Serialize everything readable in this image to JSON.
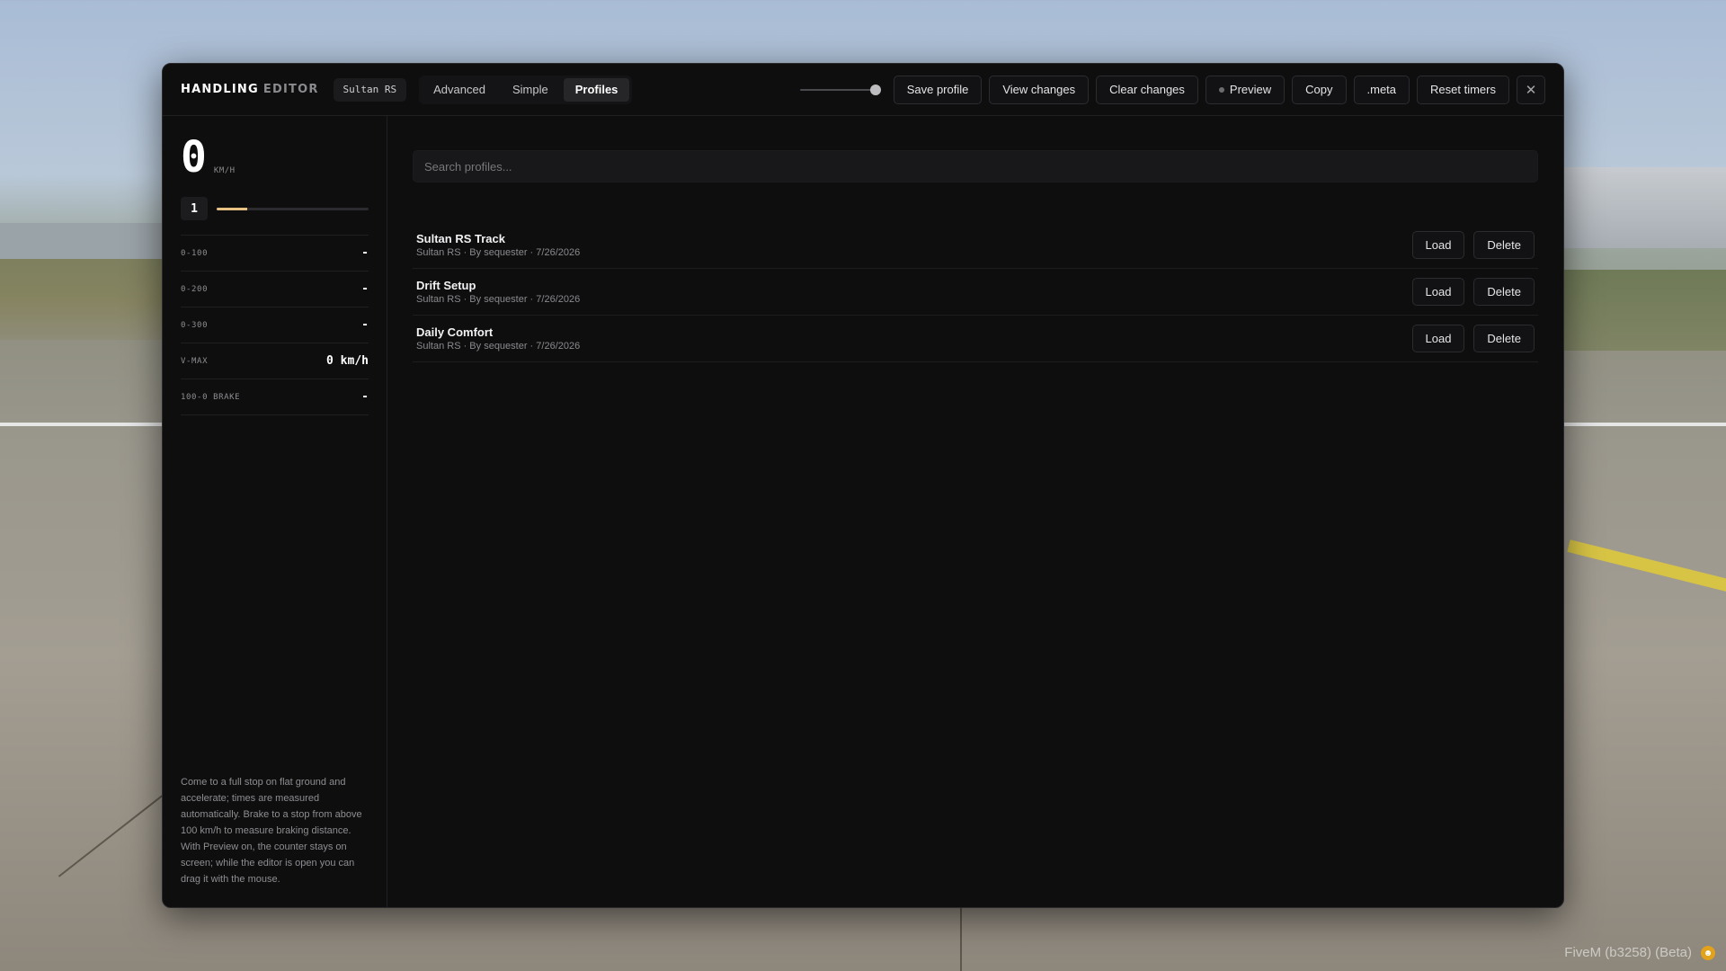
{
  "header": {
    "title_primary": "HANDLING",
    "title_secondary": "EDITOR",
    "vehicle": "Sultan RS",
    "tabs": [
      {
        "label": "Advanced",
        "active": false
      },
      {
        "label": "Simple",
        "active": false
      },
      {
        "label": "Profiles",
        "active": true
      }
    ],
    "opacity_level": 1.0,
    "buttons": {
      "save_profile": "Save profile",
      "view_changes": "View changes",
      "clear_changes": "Clear changes",
      "preview": "Preview",
      "copy": "Copy",
      "meta": ".meta",
      "reset_timers": "Reset timers",
      "close": "✕"
    }
  },
  "sidebar": {
    "speed": "0",
    "speed_unit": "KM/H",
    "gear": "1",
    "rpm_fraction": 0.2,
    "stats": [
      {
        "label": "0-100",
        "value": "-"
      },
      {
        "label": "0-200",
        "value": "-"
      },
      {
        "label": "0-300",
        "value": "-"
      },
      {
        "label": "V-MAX",
        "value": "0 km/h"
      },
      {
        "label": "100-0 BRAKE",
        "value": "-"
      }
    ],
    "hint": "Come to a full stop on flat ground and accelerate; times are measured automatically. Brake to a stop from above 100 km/h to measure braking distance. With Preview on, the counter stays on screen; while the editor is open you can drag it with the mouse."
  },
  "main": {
    "search_placeholder": "Search profiles...",
    "load_label": "Load",
    "delete_label": "Delete",
    "profiles": [
      {
        "name": "Sultan RS Track",
        "meta": "Sultan RS · By sequester · 7/26/2026"
      },
      {
        "name": "Drift Setup",
        "meta": "Sultan RS · By sequester · 7/26/2026"
      },
      {
        "name": "Daily Comfort",
        "meta": "Sultan RS · By sequester · 7/26/2026"
      }
    ]
  },
  "footer": {
    "build_label": "FiveM (b3258) (Beta)"
  },
  "colors": {
    "panel_bg": "#0e0e0f",
    "accent_rpm": "#e7c182",
    "border": "#2c2c30"
  }
}
